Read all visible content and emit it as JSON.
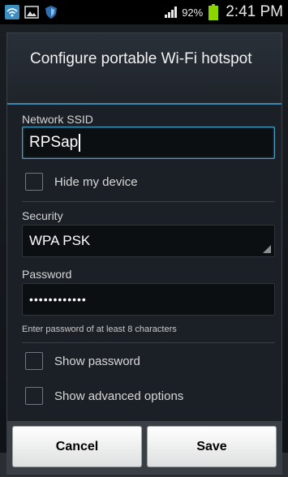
{
  "status_bar": {
    "icons_left": [
      "wifi-hotspot-icon",
      "gallery-icon",
      "shield-icon"
    ],
    "battery_percent": "92%",
    "time": "2:41 PM"
  },
  "dialog": {
    "title": "Configure portable Wi-Fi hotspot",
    "ssid_label": "Network SSID",
    "ssid_value": "RPSap",
    "hide_device_label": "Hide my device",
    "security_label": "Security",
    "security_value": "WPA PSK",
    "password_label": "Password",
    "password_value": "••••••••••••",
    "password_hint": "Enter password of at least 8 characters",
    "show_password_label": "Show password",
    "show_advanced_label": "Show advanced options",
    "cancel_label": "Cancel",
    "save_label": "Save"
  },
  "colors": {
    "focus_accent": "#4c9dc6",
    "battery": "#8bd400"
  }
}
